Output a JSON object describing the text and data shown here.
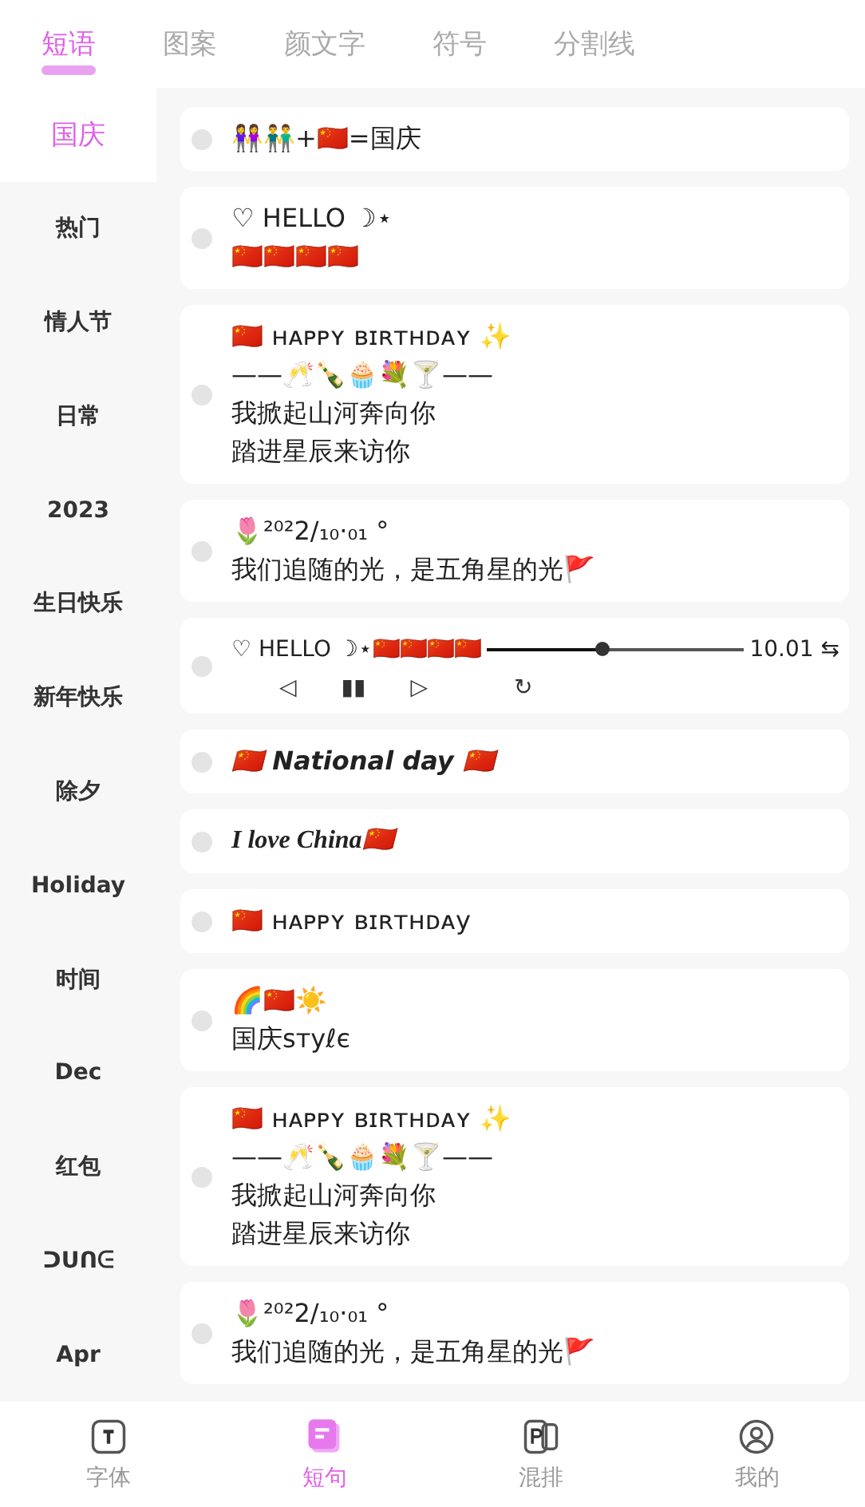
{
  "tabs": [
    {
      "label": "短语",
      "selected": true
    },
    {
      "label": "图案",
      "selected": false
    },
    {
      "label": "颜文字",
      "selected": false
    },
    {
      "label": "符号",
      "selected": false
    },
    {
      "label": "分割线",
      "selected": false
    }
  ],
  "categories": [
    {
      "label": "国庆",
      "selected": true
    },
    {
      "label": "热门",
      "selected": false
    },
    {
      "label": "情人节",
      "selected": false
    },
    {
      "label": "日常",
      "selected": false
    },
    {
      "label": "2023",
      "selected": false
    },
    {
      "label": "生日快乐",
      "selected": false
    },
    {
      "label": "新年快乐",
      "selected": false
    },
    {
      "label": "除夕",
      "selected": false
    },
    {
      "label": "Holiday",
      "selected": false
    },
    {
      "label": "时间",
      "selected": false
    },
    {
      "label": "Dec",
      "selected": false
    },
    {
      "label": "红包",
      "selected": false
    },
    {
      "label": "ᑐᑌᑎᕮ",
      "selected": false
    },
    {
      "label": "Apr",
      "selected": false
    }
  ],
  "phrases": [
    {
      "kind": "plain",
      "selected": false,
      "lines": [
        "👭👬+🇨🇳=国庆"
      ]
    },
    {
      "kind": "plain",
      "selected": false,
      "lines": [
        "♡ HELLO ☽⋆",
        "🇨🇳🇨🇳🇨🇳🇨🇳"
      ]
    },
    {
      "kind": "plain",
      "selected": false,
      "lines": [
        "🇨🇳 ʜᴀᴘᴘʏ ʙɪʀᴛʜᴅᴀʏ ✨",
        "——🥂🍾🧁💐🍸——",
        "我掀起山河奔向你",
        "踏进星辰来访你"
      ]
    },
    {
      "kind": "plain",
      "selected": false,
      "lines": [
        "🌷²⁰²2/₁₀·₀₁ °",
        "我们追随的光，是五角星的光🚩"
      ]
    },
    {
      "kind": "player",
      "selected": false,
      "lines": [
        "♡ HELLO ☽⋆🇨🇳🇨🇳🇨🇳🇨🇳",
        "10.01 ⇆",
        "◁",
        "▮▮",
        "▷",
        "↻"
      ],
      "level": 0.45
    },
    {
      "kind": "bold-italic",
      "selected": false,
      "lines": [
        "🇨🇳 National day 🇨🇳"
      ]
    },
    {
      "kind": "serif-italic",
      "selected": false,
      "lines": [
        "I love China🇨🇳"
      ]
    },
    {
      "kind": "plain",
      "selected": false,
      "lines": [
        "🇨🇳 ʜᴀᴘᴘʏ ʙɪʀᴛʜᴅᴀy"
      ]
    },
    {
      "kind": "plain",
      "selected": false,
      "lines": [
        "🌈🇨🇳☀️",
        "国庆ѕтуℓє"
      ]
    },
    {
      "kind": "plain",
      "selected": false,
      "lines": [
        "🇨🇳 ʜᴀᴘᴘʏ ʙɪʀᴛʜᴅᴀʏ ✨",
        "——🥂🍾🧁💐🍸——",
        "我掀起山河奔向你",
        "踏进星辰来访你"
      ]
    },
    {
      "kind": "plain",
      "selected": false,
      "lines": [
        "🌷²⁰²2/₁₀·₀₁ °",
        "我们追随的光，是五角星的光🚩"
      ]
    }
  ],
  "nav": [
    {
      "label": "字体",
      "selected": false
    },
    {
      "label": "短句",
      "selected": true
    },
    {
      "label": "混排",
      "selected": false
    },
    {
      "label": "我的",
      "selected": false
    }
  ]
}
